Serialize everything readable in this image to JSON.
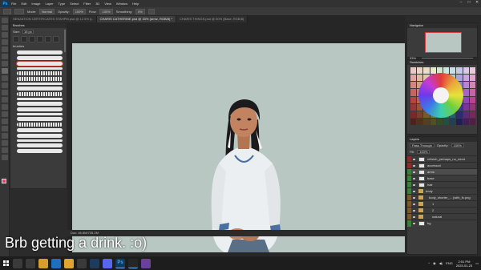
{
  "menubar": {
    "items": [
      "File",
      "Edit",
      "Image",
      "Layer",
      "Type",
      "Select",
      "Filter",
      "3D",
      "View",
      "Window",
      "Help"
    ]
  },
  "options": {
    "mode_label": "Mode:",
    "mode_value": "Normal",
    "opacity_label": "Opacity:",
    "opacity_value": "100%",
    "flow_label": "Flow:",
    "flow_value": "100%",
    "smoothing_label": "Smoothing:",
    "smoothing_value": "0%"
  },
  "tabs": [
    "SENZATION CERTIFICATES STAHPM.psd @ 12.5% (L",
    "CHARIS CATHERINE.psd @ 33% (armz, RGB/8) *",
    "CHARIS THINGS.psd @ 50% (Base, RGB/8)"
  ],
  "brushes_panel": {
    "title": "Brushes",
    "size_label": "Size:",
    "size_value": "15 px",
    "group_label": "brushes"
  },
  "status": {
    "text": "Doc: 46.8M/735.2M"
  },
  "navigator": {
    "title": "Navigator",
    "zoom": "33%"
  },
  "swatches": {
    "title": "Swatches"
  },
  "layers": {
    "title": "Layers",
    "blend_mode": "Pass Through",
    "opacity_label": "Opacity:",
    "opacity_value": "100%",
    "fill_label": "Fill:",
    "fill_value": "100%",
    "rows": [
      {
        "name": "refresh_perhaps_no_need",
        "kind": "layer",
        "tag": "#8a2b2b",
        "indent": 0
      },
      {
        "name": "accessori",
        "kind": "layer",
        "tag": "#8a2b2b",
        "indent": 0
      },
      {
        "name": "arms",
        "kind": "layer",
        "tag": "#3f7d3a",
        "indent": 0,
        "selected": true
      },
      {
        "name": "base",
        "kind": "layer",
        "tag": "#3f7d3a",
        "indent": 0
      },
      {
        "name": "hair",
        "kind": "layer",
        "tag": "#3f7d3a",
        "indent": 0
      },
      {
        "name": "body",
        "kind": "folder",
        "tag": "#3f7d3a",
        "indent": 0
      },
      {
        "name": "body_shorter_... (with_fx.png",
        "kind": "folder",
        "tag": "#7a5a2a",
        "indent": 1
      },
      {
        "name": "1",
        "kind": "folder",
        "tag": "#7a5a2a",
        "indent": 2
      },
      {
        "name": "2",
        "kind": "folder",
        "tag": "#7a5a2a",
        "indent": 2
      },
      {
        "name": "natural",
        "kind": "folder",
        "tag": "#7a5a2a",
        "indent": 2
      },
      {
        "name": "bg",
        "kind": "layer",
        "tag": "#3f7d3a",
        "indent": 0
      }
    ]
  },
  "subtitle": "Brb getting a drink. :o)",
  "taskbar": {
    "search_placeholder": "",
    "tray": {
      "lang": "ENG",
      "time": "2:51 PM",
      "date": "2023-01-23"
    }
  }
}
